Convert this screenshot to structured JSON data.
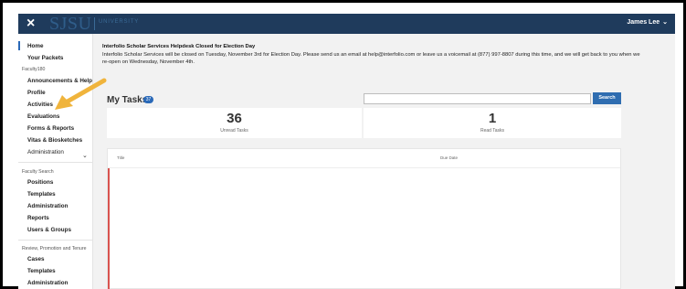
{
  "header": {
    "close_icon": "×",
    "brand": "SJSU",
    "brand_sub": "UNIVERSITY",
    "user_name": "James Lee",
    "user_chevron": "⌄"
  },
  "sidebar": {
    "items": [
      {
        "label": "Home"
      },
      {
        "label": "Your Packets"
      },
      {
        "label": "Announcements & Help"
      },
      {
        "label": "Profile"
      },
      {
        "label": "Activities"
      },
      {
        "label": "Evaluations"
      },
      {
        "label": "Forms & Reports"
      },
      {
        "label": "Vitas & Biosketches"
      },
      {
        "label": "Administration"
      },
      {
        "label": "Positions"
      },
      {
        "label": "Templates"
      },
      {
        "label": "Administration"
      },
      {
        "label": "Reports"
      },
      {
        "label": "Users & Groups"
      },
      {
        "label": "Cases"
      },
      {
        "label": "Templates"
      },
      {
        "label": "Administration"
      }
    ],
    "sections": {
      "faculty180": "Faculty180",
      "faculty_search": "Faculty Search",
      "rpt": "Review, Promotion and Tenure"
    },
    "admin_chevron": "⌄"
  },
  "notice": {
    "title": "Interfolio Scholar Services Helpdesk Closed for Election Day",
    "body": "Interfolio Scholar Services will be closed on Tuesday, November 3rd for Election Day. Please send us an email at help@interfolio.com or leave us a voicemail at (877) 997-8807 during this time, and we will get back to you when we re-open on Wednesday, November 4th."
  },
  "tasks": {
    "heading": "My Tasks",
    "badge": "37",
    "search_placeholder": "",
    "search_button": "Search",
    "unread_count": "36",
    "unread_label": "Unread Tasks",
    "read_count": "1",
    "read_label": "Read Tasks",
    "col_title": "Title",
    "col_due": "Due Date"
  },
  "colors": {
    "topbar": "#1f3b5c",
    "accent": "#2a69b8",
    "arrow": "#f0b43c",
    "row_accent": "#d9534f"
  }
}
